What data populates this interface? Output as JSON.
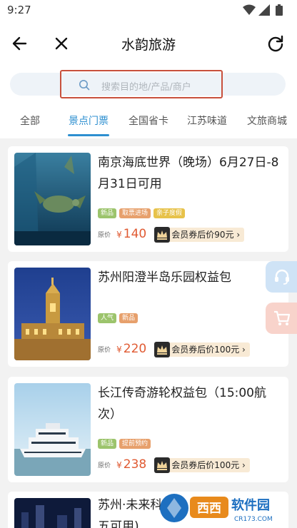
{
  "status_bar": {
    "time": "9:27"
  },
  "nav": {
    "title": "水韵旅游",
    "back_icon": "arrow-left-icon",
    "close_icon": "close-icon",
    "refresh_icon": "refresh-icon"
  },
  "search": {
    "placeholder": "搜索目的地/产品/商户",
    "icon": "search-icon"
  },
  "tabs": [
    {
      "label": "全部",
      "active": false
    },
    {
      "label": "景点门票",
      "active": true
    },
    {
      "label": "全国省卡",
      "active": false
    },
    {
      "label": "江苏味道",
      "active": false
    },
    {
      "label": "文旅商城",
      "active": false
    }
  ],
  "products": [
    {
      "title": "南京海底世界（晚场）6月27日-8月31日可用",
      "tags": [
        "新品",
        "取票进场",
        "亲子度假"
      ],
      "orig_label": "原价",
      "currency": "¥",
      "price": "140",
      "member_text": "会员券后价90元",
      "chevron": "›"
    },
    {
      "title": "苏州阳澄半岛乐园权益包",
      "tags": [
        "人气",
        "新品"
      ],
      "orig_label": "原价",
      "currency": "¥",
      "price": "220",
      "member_text": "会员券后价100元",
      "chevron": "›"
    },
    {
      "title": "长江传奇游轮权益包（15:00航次）",
      "tags": [
        "新品",
        "提前预约"
      ],
      "orig_label": "原价",
      "currency": "¥",
      "price": "238",
      "member_text": "会员券后价100元",
      "chevron": "›"
    },
    {
      "title": "苏州·未来科幻",
      "title_line2": "五可用)"
    }
  ],
  "floating": {
    "service_icon": "headset-icon",
    "cart_icon": "cart-icon"
  },
  "watermark": {
    "logo_text": "西西",
    "brand": "软件园",
    "site": "CR173.COM"
  },
  "colors": {
    "accent": "#2d8fd0",
    "price": "#e05a32",
    "highlight_border": "#c8503c"
  }
}
